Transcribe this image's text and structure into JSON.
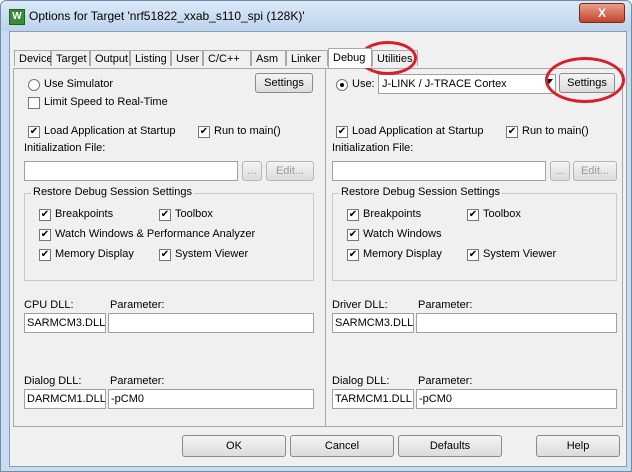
{
  "window": {
    "title": "Options for Target 'nrf51822_xxab_s110_spi (128K)'",
    "close": "X"
  },
  "tabs": [
    {
      "label": "Device"
    },
    {
      "label": "Target"
    },
    {
      "label": "Output"
    },
    {
      "label": "Listing"
    },
    {
      "label": "User"
    },
    {
      "label": "C/C++"
    },
    {
      "label": "Asm"
    },
    {
      "label": "Linker"
    },
    {
      "label": "Debug"
    },
    {
      "label": "Utilities"
    }
  ],
  "left": {
    "use_simulator": "Use Simulator",
    "settings": "Settings",
    "limit_speed": "Limit Speed to Real-Time",
    "load_app": "Load Application at Startup",
    "run_to_main": "Run to main()",
    "init_file_label": "Initialization File:",
    "browse": "...",
    "edit": "Edit...",
    "restore_title": "Restore Debug Session Settings",
    "breakpoints": "Breakpoints",
    "toolbox": "Toolbox",
    "watch": "Watch Windows & Performance Analyzer",
    "memory": "Memory Display",
    "sysviewer": "System Viewer",
    "cpu_dll_label": "CPU DLL:",
    "cpu_param_label": "Parameter:",
    "cpu_dll": "SARMCM3.DLL",
    "cpu_param": "",
    "dialog_dll_label": "Dialog DLL:",
    "dialog_param_label": "Parameter:",
    "dialog_dll": "DARMCM1.DLL",
    "dialog_param": "-pCM0"
  },
  "right": {
    "use": "Use:",
    "driver": "J-LINK / J-TRACE Cortex",
    "settings": "Settings",
    "load_app": "Load Application at Startup",
    "run_to_main": "Run to main()",
    "init_file_label": "Initialization File:",
    "browse": "...",
    "edit": "Edit...",
    "restore_title": "Restore Debug Session Settings",
    "breakpoints": "Breakpoints",
    "toolbox": "Toolbox",
    "watch": "Watch Windows",
    "memory": "Memory Display",
    "sysviewer": "System Viewer",
    "driver_dll_label": "Driver DLL:",
    "driver_param_label": "Parameter:",
    "driver_dll": "SARMCM3.DLL",
    "driver_param": "",
    "dialog_dll_label": "Dialog DLL:",
    "dialog_param_label": "Parameter:",
    "dialog_dll": "TARMCM1.DLL",
    "dialog_param": "-pCM0"
  },
  "footer": {
    "ok": "OK",
    "cancel": "Cancel",
    "defaults": "Defaults",
    "help": "Help"
  },
  "colors": {
    "annotation": "#d8202a"
  },
  "check_mark": "✔"
}
